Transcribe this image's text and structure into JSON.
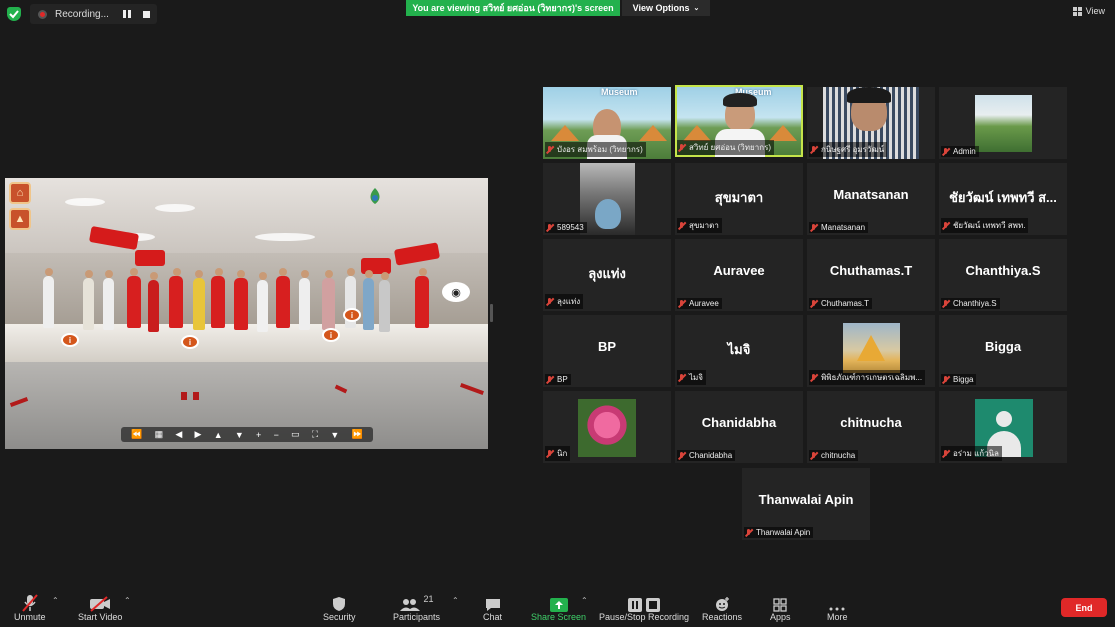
{
  "top": {
    "recording_label": "Recording...",
    "viewing_banner": "You are viewing สวิทย์ ยศอ่อน (วิทยากร)'s screen",
    "view_options_label": "View Options",
    "view_label": "View"
  },
  "tiles": [
    {
      "name": "บังอร สมพร้อม (วิทยากร)",
      "type": "video"
    },
    {
      "name": "สวิทย์ ยศอ่อน (วิทยากร)",
      "type": "video"
    },
    {
      "name": "กนิษฐศรี อุมรวัฒน์",
      "type": "video"
    },
    {
      "name": "Admin",
      "type": "image"
    },
    {
      "name": "589543",
      "type": "image"
    },
    {
      "name": "สุขมาตา",
      "display": "สุขมาตา"
    },
    {
      "name": "Manatsanan",
      "display": "Manatsanan"
    },
    {
      "name": "ชัยวัฒน์ เทพทวี สพท.",
      "display": "ชัยวัฒน์ เทพทวี ส..."
    },
    {
      "name": "ลุงแท่ง",
      "display": "ลุงแท่ง"
    },
    {
      "name": "Auravee",
      "display": "Auravee"
    },
    {
      "name": "Chuthamas.T",
      "display": "Chuthamas.T"
    },
    {
      "name": "Chanthiya.S",
      "display": "Chanthiya.S"
    },
    {
      "name": "BP",
      "display": "BP"
    },
    {
      "name": "ไมจิ",
      "display": "ไมจิ"
    },
    {
      "name": "พิพิธภัณฑ์การเกษตรเฉลิมพ...",
      "type": "image"
    },
    {
      "name": "Bigga",
      "display": "Bigga"
    },
    {
      "name": "นิก",
      "type": "image"
    },
    {
      "name": "Chanidabha",
      "display": "Chanidabha"
    },
    {
      "name": "chitnucha",
      "display": "chitnucha"
    },
    {
      "name": "อร่าม แก้วนิล",
      "type": "avatar"
    },
    {
      "name": "Thanwalai Apin",
      "display": "Thanwalai Apin"
    }
  ],
  "toolbar": {
    "unmute": "Unmute",
    "start_video": "Start Video",
    "security": "Security",
    "participants": "Participants",
    "participants_count": "21",
    "chat": "Chat",
    "share_screen": "Share Screen",
    "pause_stop_recording": "Pause/Stop Recording",
    "reactions": "Reactions",
    "apps": "Apps",
    "more": "More",
    "end": "End"
  },
  "colors": {
    "background": "#1a1a1a",
    "tile": "#242424",
    "green": "#23b14d",
    "active_speaker": "#c5e54a",
    "end_button": "#e02828",
    "muted_icon": "#d9443a"
  }
}
